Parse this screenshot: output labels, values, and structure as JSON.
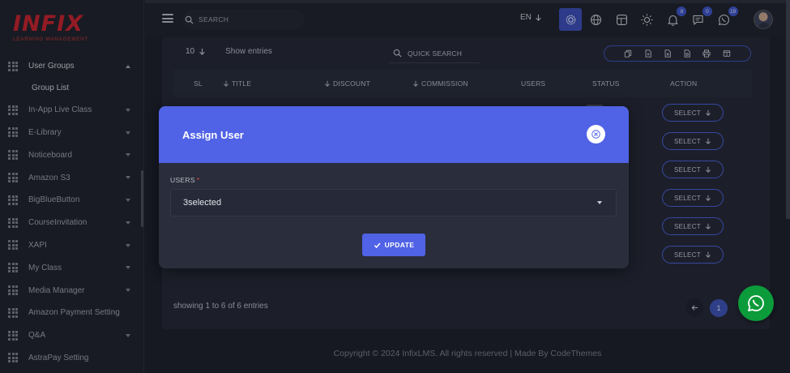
{
  "brand": {
    "logo_text": "INFIX",
    "logo_sub": "LEARNING MANAGEMENT",
    "logo_color": "#c8202a"
  },
  "sidebar": {
    "items": [
      {
        "label": "User Groups",
        "expanded": true,
        "submenu": [
          "Group List"
        ]
      },
      {
        "label": "In-App Live Class"
      },
      {
        "label": "E-Library"
      },
      {
        "label": "Noticeboard"
      },
      {
        "label": "Amazon S3"
      },
      {
        "label": "BigBlueButton"
      },
      {
        "label": "CourseInvitation"
      },
      {
        "label": "XAPI"
      },
      {
        "label": "My Class"
      },
      {
        "label": "Media Manager"
      },
      {
        "label": "Amazon Payment Setting"
      },
      {
        "label": "Q&A"
      },
      {
        "label": "AstraPay Setting"
      }
    ]
  },
  "topbar": {
    "search_placeholder": "SEARCH",
    "language": "EN",
    "icons": [
      "gear-icon",
      "globe-icon",
      "layout-icon",
      "sun-icon",
      "bell-icon",
      "chat-icon",
      "whatsapp-icon"
    ],
    "badges": {
      "notifications": "8",
      "messages": "0",
      "whatsapp": "19"
    },
    "accent": "#3b4db8"
  },
  "table": {
    "entries_count": "10",
    "entries_label": "Show entries",
    "quick_search": "QUICK SEARCH",
    "export_icons": [
      "copy-icon",
      "csv-icon",
      "excel-icon",
      "pdf-icon",
      "print-icon",
      "columns-icon"
    ],
    "columns": [
      "SL",
      "TITLE",
      "DISCOUNT",
      "COMMISSION",
      "USERS",
      "STATUS",
      "ACTION"
    ],
    "action_label": "SELECT",
    "row_count": 6,
    "showing_text": "showing 1 to 6 of 6 entries",
    "current_page": "1"
  },
  "footer": {
    "copyright": "Copyright © 2024 InfixLMS. All rights reserved | Made By CodeThemes"
  },
  "modal": {
    "title": "Assign User",
    "users_label": "USERS",
    "required_mark": "*",
    "selected_value": "3selected",
    "update_label": "UPDATE",
    "header_color": "#5062e5"
  },
  "floating": {
    "whatsapp_color": "#0c9b3b"
  }
}
